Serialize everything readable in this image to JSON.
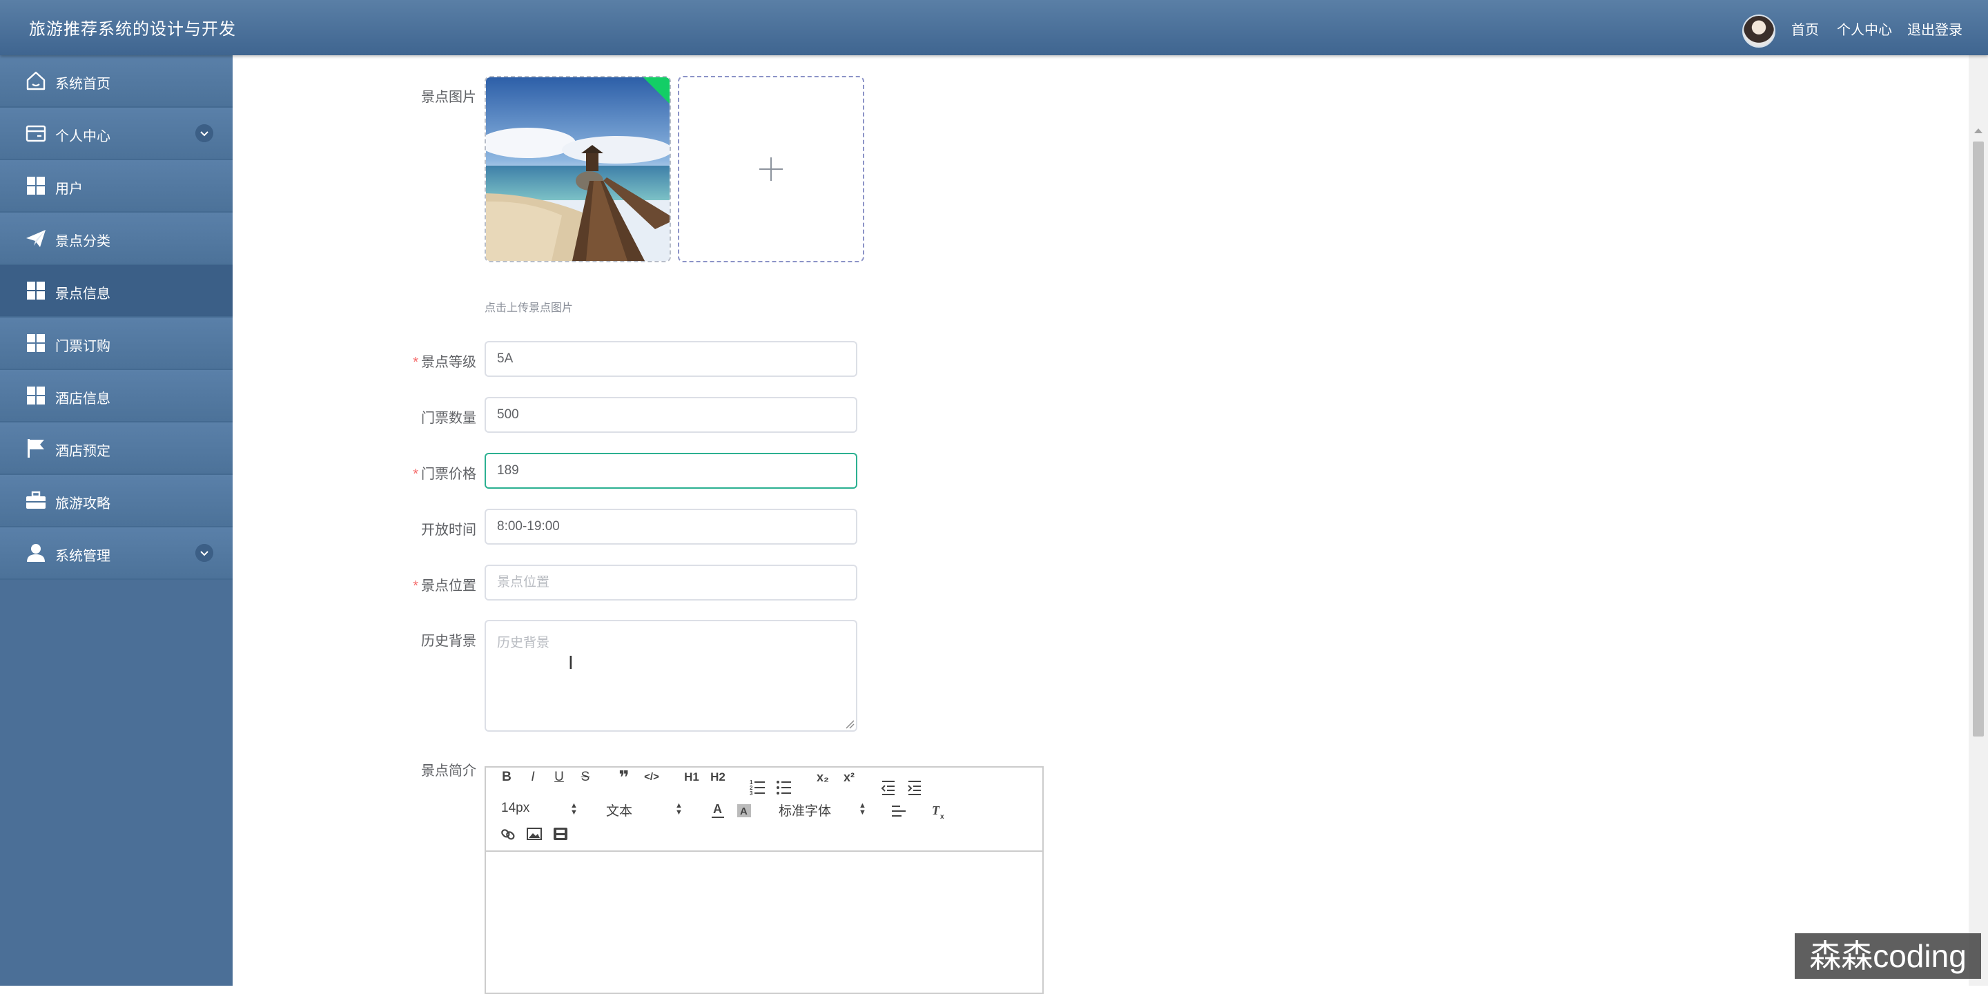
{
  "header": {
    "title": "旅游推荐系统的设计与开发",
    "links": {
      "home": "首页",
      "profile": "个人中心",
      "logout": "退出登录"
    }
  },
  "sidebar": {
    "items": [
      {
        "label": "系统首页",
        "icon": "home-icon"
      },
      {
        "label": "个人中心",
        "icon": "wallet-icon",
        "expandable": true
      },
      {
        "label": "用户",
        "icon": "grid-icon"
      },
      {
        "label": "景点分类",
        "icon": "paper-plane-icon"
      },
      {
        "label": "景点信息",
        "icon": "grid-icon",
        "active": true
      },
      {
        "label": "门票订购",
        "icon": "grid-icon"
      },
      {
        "label": "酒店信息",
        "icon": "grid-icon"
      },
      {
        "label": "酒店预定",
        "icon": "flag-icon"
      },
      {
        "label": "旅游攻略",
        "icon": "briefcase-icon"
      },
      {
        "label": "系统管理",
        "icon": "user-icon",
        "expandable": true
      }
    ]
  },
  "form": {
    "image": {
      "label": "景点图片",
      "hint": "点击上传景点图片"
    },
    "level": {
      "label": "景点等级",
      "value": "5A",
      "required": true
    },
    "ticket_count": {
      "label": "门票数量",
      "value": "500"
    },
    "ticket_price": {
      "label": "门票价格",
      "value": "189",
      "required": true
    },
    "open_time": {
      "label": "开放时间",
      "value": "8:00-19:00"
    },
    "location": {
      "label": "景点位置",
      "placeholder": "景点位置",
      "required": true
    },
    "history": {
      "label": "历史背景",
      "placeholder": "历史背景"
    },
    "intro": {
      "label": "景点简介"
    }
  },
  "editor": {
    "row1": [
      "B",
      "I",
      "U",
      "S",
      "❞",
      "</>",
      "H1",
      "H2",
      "ol",
      "ul",
      "x₂",
      "x²",
      "outdent",
      "indent"
    ],
    "font_size": "14px",
    "block_type": "文本",
    "font_family": "标准字体"
  },
  "watermark": "森森coding",
  "colors": {
    "header": "#4a7099",
    "sidebar": "#4b6f97",
    "focus": "#2bb091",
    "required": "#f56c6c"
  }
}
